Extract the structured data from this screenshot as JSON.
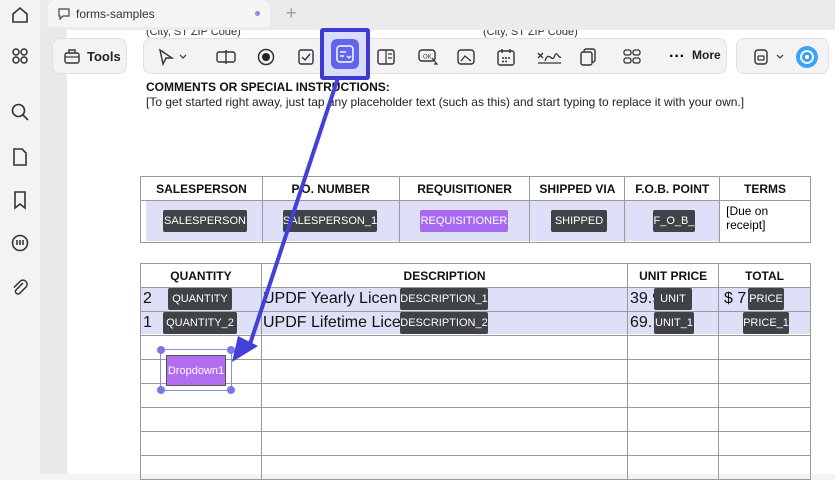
{
  "tab": {
    "title": "forms-samples",
    "plus": "+"
  },
  "sidebar": {
    "icons": [
      "home-icon",
      "grid-icon",
      "search-icon",
      "document-icon",
      "bookmark-icon",
      "comment-icon",
      "attachment-icon"
    ]
  },
  "toolbar": {
    "tools_label": "Tools",
    "more_label": "More",
    "more_dots": "···"
  },
  "page": {
    "peek_left": "(City, ST ZIP Code)",
    "peek_right": "(City, ST ZIP Code)",
    "comments_heading": "COMMENTS OR SPECIAL INSTRUCTIONS:",
    "comments_text": "[To get started right away, just tap any placeholder text (such as this) and start typing to replace it with your own.]"
  },
  "table1": {
    "headers": [
      "SALESPERSON",
      "P.O. NUMBER",
      "REQUISITIONER",
      "SHIPPED VIA",
      "F.O.B. POINT",
      "TERMS"
    ],
    "fields": [
      "SALESPERSON",
      "SALESPERSON_1",
      "REQUISITIONER",
      "SHIPPED",
      "F_O_B_"
    ],
    "terms_value": "[Due on receipt]"
  },
  "table2": {
    "headers": [
      "QUANTITY",
      "DESCRIPTION",
      "UNIT PRICE",
      "TOTAL"
    ],
    "rows": [
      {
        "qty": "2",
        "desc": "UPDF Yearly Licen",
        "price": "39.9",
        "total": "$ 7",
        "f_qty": "QUANTITY",
        "f_desc": "DESCRIPTION_1",
        "f_unit": "UNIT",
        "f_price": "PRICE"
      },
      {
        "qty": "1",
        "desc": "UPDF Lifetime Lice",
        "price": "69.",
        "total": "",
        "f_qty": "QUANTITY_2",
        "f_desc": "DESCRIPTION_2",
        "f_unit": "UNIT_1",
        "f_price": "PRICE_1"
      }
    ],
    "dropdown_label": "Dropdown1"
  }
}
